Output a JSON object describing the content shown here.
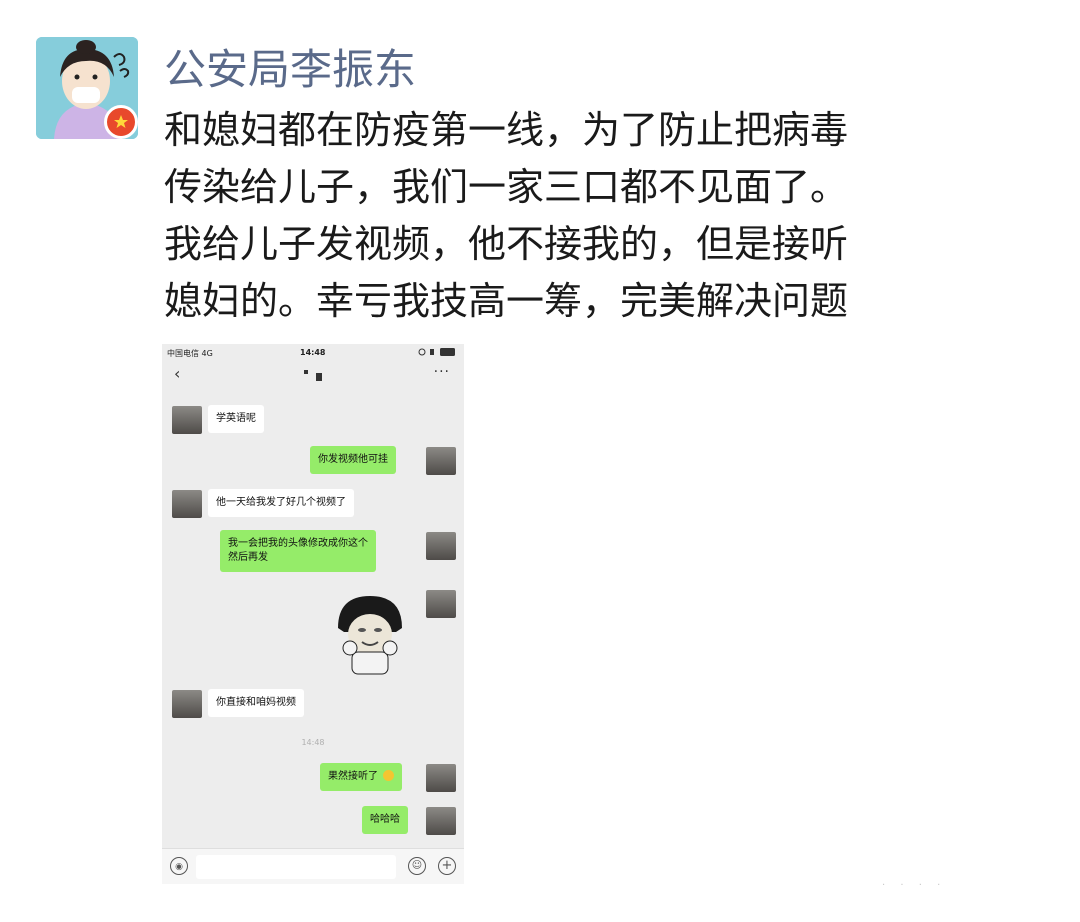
{
  "post": {
    "author": "公安局李振东",
    "lines": [
      "和媳妇都在防疫第一线，为了防止把病毒",
      "传染给儿子，我们一家三口都不见面了。",
      "我给儿子发视频，他不接我的，但是接听",
      "媳妇的。幸亏我技高一筹，完美解决问题"
    ]
  },
  "phone": {
    "status": {
      "carrier": "中国电信 4G",
      "time": "14:48"
    },
    "messages": {
      "m1": "学英语呢",
      "m2": "你发视频他可挂",
      "m3": "他一天给我发了好几个视频了",
      "m4_line1": "我一会把我的头像修改成你这个",
      "m4_line2": "然后再发",
      "m5": "你直接和咱妈视频",
      "divider_time": "14:48",
      "m6": "果然接听了",
      "m7": "哈哈哈"
    },
    "icons": {
      "back": "back-chevron-icon",
      "more": "more-dots-icon",
      "voice": "voice-icon",
      "emoji": "emoji-icon",
      "plus": "plus-icon"
    },
    "colors": {
      "outgoing_bubble": "#95ec69",
      "incoming_bubble": "#ffffff",
      "chat_bg": "#ededed"
    }
  },
  "colors": {
    "author_name": "#5a6a8a",
    "post_text": "#1a1a1a"
  }
}
